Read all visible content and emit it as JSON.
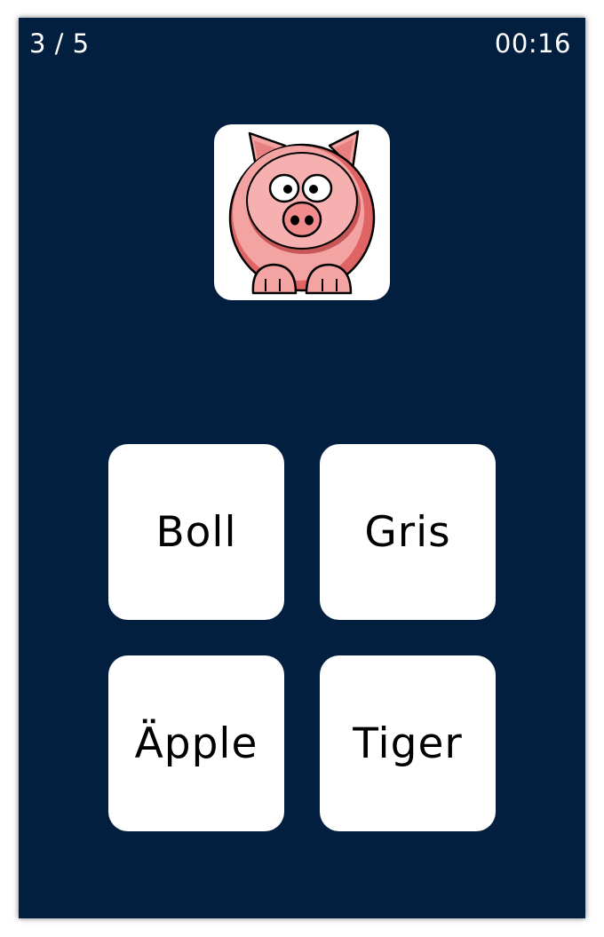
{
  "header": {
    "progress": "3 / 5",
    "timer": "00:16"
  },
  "question": {
    "image_icon": "pig-icon"
  },
  "answers": [
    {
      "label": "Boll"
    },
    {
      "label": "Gris"
    },
    {
      "label": "Äpple"
    },
    {
      "label": "Tiger"
    }
  ],
  "colors": {
    "background": "#021f3f",
    "card": "#ffffff",
    "text_light": "#ffffff",
    "text_dark": "#000000"
  }
}
